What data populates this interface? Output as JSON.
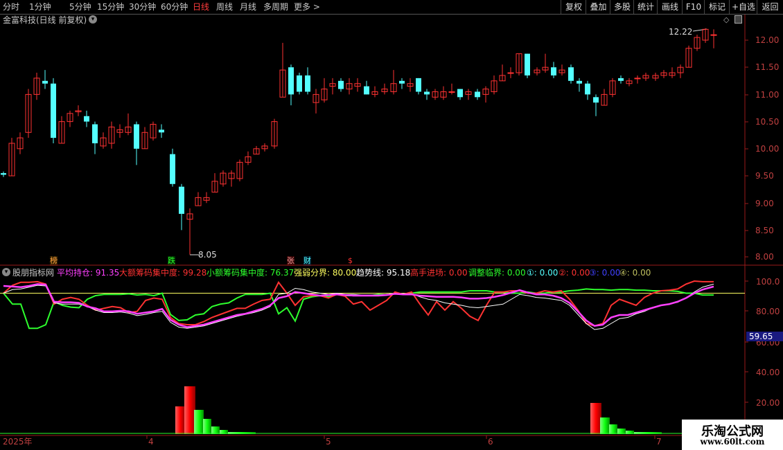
{
  "toolbar": {
    "periods": [
      "分时",
      "1分钟",
      "5分钟",
      "15分钟",
      "30分钟",
      "60分钟",
      "日线",
      "周线",
      "月线",
      "多周期",
      "更多 >"
    ],
    "active_period": "日线",
    "right_buttons": [
      "复权",
      "叠加",
      "多股",
      "统计",
      "画线",
      "F10",
      "标记",
      "+自选",
      "返回"
    ]
  },
  "stock": {
    "title": "金富科技(日线 前复权)"
  },
  "colors": {
    "up": "#ff3232",
    "down": "#54ffff",
    "white": "#ffffff",
    "magenta": "#ff40ff",
    "green": "#2dff2d",
    "yellow": "#ffff60",
    "axis_red": "#b02020"
  },
  "price_panel": {
    "y_ticks": [
      "12.00",
      "11.50",
      "11.00",
      "10.50",
      "10.00",
      "9.50",
      "9.00",
      "8.50",
      "8.00"
    ],
    "max_label": "12.22",
    "min_label": "8.05"
  },
  "event_markers": [
    {
      "text": "榜",
      "color": "#ffa040"
    },
    {
      "text": "跌",
      "color": "#2dff2d"
    },
    {
      "text": "张",
      "color": "#ffa0a0"
    },
    {
      "text": "财",
      "color": "#54ffff"
    },
    {
      "text": "$",
      "color": "#ff3232"
    }
  ],
  "indicator": {
    "name": "股朋指标网",
    "lines": [
      {
        "label": "平均持仓: 91.35",
        "color": "#ff40ff"
      },
      {
        "label": "大额筹码集中度: 99.28",
        "color": "#ff3232"
      },
      {
        "label": "小额筹码集中度: 76.37",
        "color": "#2dff2d"
      },
      {
        "label": "强弱分界: 80.00",
        "color": "#ffff60"
      },
      {
        "label": "趋势线: 95.18",
        "color": "#ffffff"
      },
      {
        "label": "高手进场: 0.00",
        "color": "#ff3232"
      },
      {
        "label": "调整临界: 0.00",
        "color": "#2dff2d"
      },
      {
        "label": "①: 0.00",
        "color": "#54ffff"
      },
      {
        "label": "②: 0.00",
        "color": "#ff3232"
      },
      {
        "label": "③: 0.00",
        "color": "#4040ff"
      },
      {
        "label": "④: 0.00",
        "color": "#c0c060"
      }
    ],
    "y_ticks": [
      "100.0",
      "80.00",
      "60.00",
      "40.00",
      "20.00"
    ],
    "current_value": "59.65"
  },
  "time_axis": [
    "2025年",
    "4",
    "5",
    "6",
    "7"
  ],
  "watermark": {
    "line1": "乐淘公式网",
    "line2": "www.60lt.com"
  }
}
